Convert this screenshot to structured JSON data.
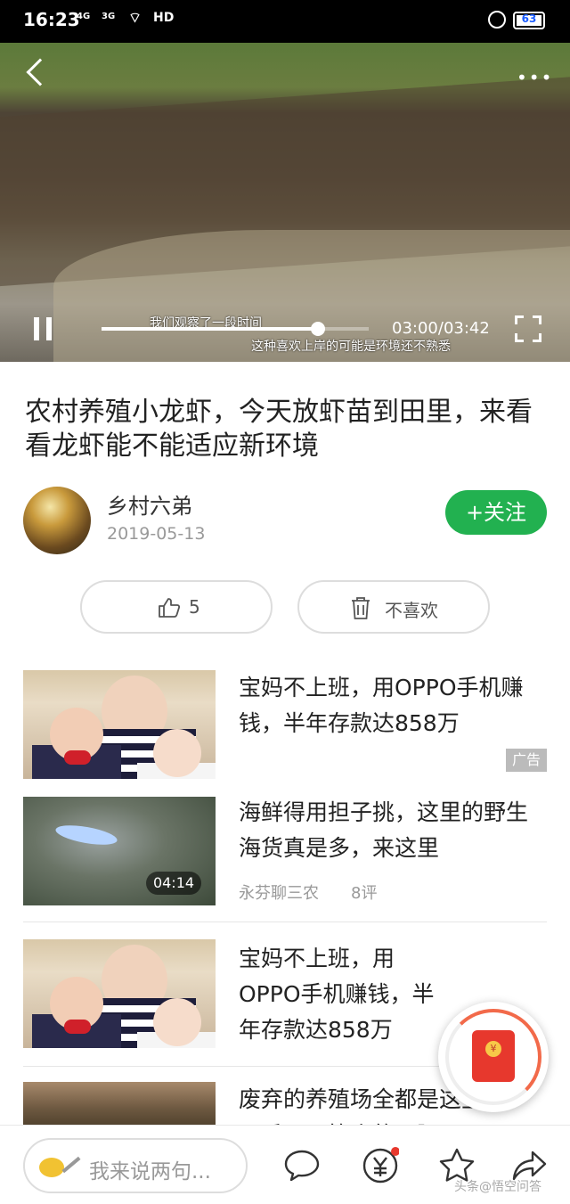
{
  "status_bar": {
    "time": "16:23",
    "signal1": "4G",
    "signal2": "3G",
    "hd": "HD",
    "battery": "63"
  },
  "video": {
    "current_time": "03:00",
    "duration": "03:42",
    "progress_fraction": 0.81,
    "subtitle_line1": "我们观察了一段时间",
    "subtitle_line2": "这种喜欢上岸的可能是环境还不熟悉"
  },
  "article": {
    "title": "农村养殖小龙虾，今天放虾苗到田里，来看看龙虾能不能适应新环境",
    "author": "乡村六弟",
    "date": "2019-05-13",
    "follow_label": "+关注",
    "like_count": "5",
    "dislike_label": "不喜欢"
  },
  "feed": [
    {
      "title": "宝妈不上班，用OPPO手机赚钱，半年存款达858万",
      "ad_label": "广告"
    },
    {
      "title": "海鲜得用担子挑，这里的野生海货真是多，来这里",
      "duration": "04:14",
      "source": "永芬聊三农",
      "comments": "8评"
    },
    {
      "title": "宝妈不上班，用OPPO手机赚钱，半年存款达858万"
    },
    {
      "title": "废弃的养殖场全都是这些蟹，两斤一只算小的，阿"
    }
  ],
  "bottom_bar": {
    "comment_placeholder": "我来说两句...",
    "watermark": "头条@悟空问答"
  },
  "colors": {
    "accent": "#22b150",
    "red_packet": "#e7382d"
  }
}
